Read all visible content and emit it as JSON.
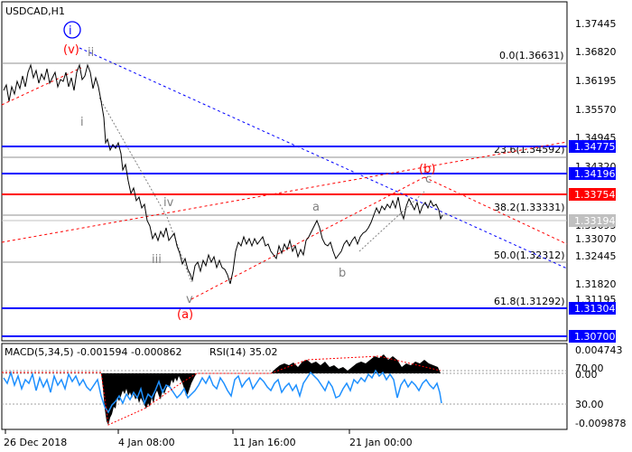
{
  "header": {
    "symbol_timeframe": "USDCAD,H1"
  },
  "indicator_header": {
    "macd_text": "MACD(5,34,5) -0.001594 -0.000862",
    "rsi_text": "RSI(14) 35.02"
  },
  "price_axis": {
    "ticks": [
      "1.37445",
      "1.36820",
      "1.36195",
      "1.35570",
      "1.34945",
      "1.34320",
      "1.33695",
      "1.33070",
      "1.32445",
      "1.31820",
      "1.31195"
    ]
  },
  "horizontal_levels": [
    {
      "label": "1.34775",
      "color": "#0000ff"
    },
    {
      "label": "1.34196",
      "color": "#0000ff"
    },
    {
      "label": "1.33754",
      "color": "#ff0000"
    },
    {
      "label": "1.33194",
      "color": "#c0c0c0"
    },
    {
      "label": "1.31304",
      "color": "#0000ff"
    },
    {
      "label": "1.30700",
      "color": "#0000ff"
    }
  ],
  "fibonacci_levels": [
    {
      "label": "0.0(1.36631)"
    },
    {
      "label": "23.6(1.34592)"
    },
    {
      "label": "38.2(1.33331)"
    },
    {
      "label": "50.0(1.32312)"
    },
    {
      "label": "61.8(1.31292)"
    }
  ],
  "wave_labels": [
    {
      "text": "i",
      "color": "#0000ff"
    },
    {
      "text": "(v)",
      "color": "#ff0000"
    },
    {
      "text": "ii",
      "color": "#808080"
    },
    {
      "text": "i",
      "color": "#808080"
    },
    {
      "text": "iii",
      "color": "#808080"
    },
    {
      "text": "iv",
      "color": "#808080"
    },
    {
      "text": "v",
      "color": "#808080"
    },
    {
      "text": "(a)",
      "color": "#ff0000"
    },
    {
      "text": "a",
      "color": "#808080"
    },
    {
      "text": "b",
      "color": "#808080"
    },
    {
      "text": "c",
      "color": "#808080"
    },
    {
      "text": "(b)",
      "color": "#ff0000"
    }
  ],
  "indicator_axis": {
    "ticks": [
      "0.004743",
      "70.00",
      "0.00",
      "30.00",
      "-0.009878"
    ]
  },
  "time_axis": {
    "ticks": [
      "26 Dec 2018",
      "4 Jan 08:00",
      "11 Jan 16:00",
      "21 Jan 00:00"
    ]
  },
  "colors": {
    "price_line": "#000000",
    "level_blue": "#0000ff",
    "level_red": "#ff0000",
    "trend_blue": "#0000ff",
    "trend_red": "#ff0000",
    "rsi_line": "#1e90ff",
    "macd_hist": "#000000"
  }
}
